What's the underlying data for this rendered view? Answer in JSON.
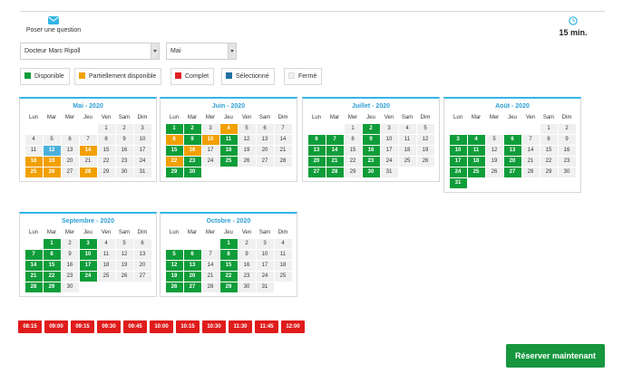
{
  "header": {
    "ask_label": "Poser une question",
    "duration": "15 min."
  },
  "filters": {
    "doctor": "Docteur Marc Ripoll",
    "month": "Mai"
  },
  "legend": [
    {
      "label": "Disponible",
      "color": "#0f9d3a"
    },
    {
      "label": "Partiellement disponible",
      "color": "#f2a000"
    },
    {
      "label": "Complet",
      "color": "#e02020"
    },
    {
      "label": "Sélectionné",
      "color": "#1f6f9f"
    },
    {
      "label": "Fermé",
      "color": "#f0f0f0"
    }
  ],
  "weekdays": [
    "Lun",
    "Mar",
    "Mer",
    "Jeu",
    "Ven",
    "Sam",
    "Dim"
  ],
  "months": [
    {
      "title": "Mai - 2020",
      "offset": 4,
      "days": 31,
      "status": {
        "12": "sel",
        "14": "part",
        "18": "part",
        "19": "part",
        "25": "part",
        "26": "part",
        "28": "part"
      }
    },
    {
      "title": "Juin - 2020",
      "offset": 0,
      "days": 30,
      "status": {
        "1": "avail",
        "2": "avail",
        "4": "part",
        "8": "part",
        "9": "avail",
        "10": "part",
        "11": "avail",
        "15": "avail",
        "16": "part",
        "18": "avail",
        "22": "part",
        "23": "avail",
        "25": "avail",
        "29": "avail",
        "30": "avail"
      }
    },
    {
      "title": "Juillet - 2020",
      "offset": 2,
      "days": 31,
      "status": {
        "2": "avail",
        "6": "avail",
        "7": "avail",
        "9": "avail",
        "13": "avail",
        "14": "avail",
        "16": "avail",
        "20": "avail",
        "21": "avail",
        "23": "avail",
        "27": "avail",
        "28": "avail",
        "30": "avail"
      }
    },
    {
      "title": "Août - 2020",
      "offset": 5,
      "days": 31,
      "status": {
        "3": "avail",
        "4": "avail",
        "6": "avail",
        "10": "avail",
        "11": "avail",
        "13": "avail",
        "17": "avail",
        "18": "avail",
        "20": "avail",
        "24": "avail",
        "25": "avail",
        "27": "avail",
        "31": "avail"
      }
    },
    {
      "title": "Septembre - 2020",
      "offset": 1,
      "days": 30,
      "status": {
        "1": "avail",
        "3": "avail",
        "7": "avail",
        "8": "avail",
        "10": "avail",
        "14": "avail",
        "15": "avail",
        "17": "avail",
        "21": "avail",
        "22": "avail",
        "24": "avail",
        "28": "avail",
        "29": "avail"
      }
    },
    {
      "title": "Octobre - 2020",
      "offset": 3,
      "days": 31,
      "status": {
        "1": "avail",
        "5": "avail",
        "6": "avail",
        "8": "avail",
        "12": "avail",
        "13": "avail",
        "15": "avail",
        "19": "avail",
        "20": "avail",
        "22": "avail",
        "26": "avail",
        "27": "avail",
        "29": "avail"
      }
    }
  ],
  "slots": [
    "08:15",
    "09:00",
    "09:15",
    "09:30",
    "09:45",
    "10:00",
    "10:15",
    "10:30",
    "11:30",
    "11:45",
    "12:00"
  ],
  "book_label": "Réserver maintenant"
}
